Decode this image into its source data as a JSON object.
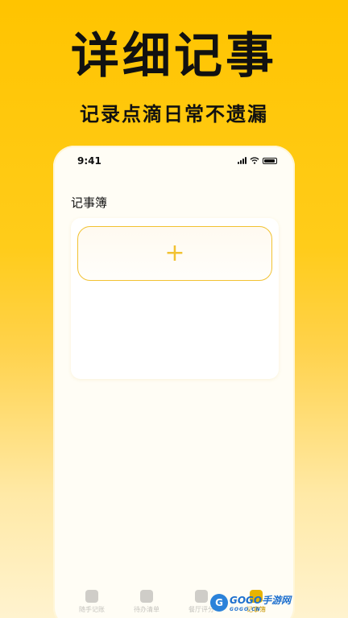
{
  "hero": {
    "title": "详细记事",
    "subtitle": "记录点滴日常不遗漏"
  },
  "status_bar": {
    "time": "9:41"
  },
  "screen": {
    "title": "记事簿",
    "add_button_label": "+"
  },
  "tabbar": {
    "items": [
      {
        "label": "随手记账",
        "icon": "edit-document-icon"
      },
      {
        "label": "待办清单",
        "icon": "list-icon"
      },
      {
        "label": "餐厅评分",
        "icon": "dining-icon"
      },
      {
        "label": "记事簿",
        "icon": "notebook-icon",
        "active": true
      }
    ]
  },
  "watermark": {
    "logo": "G",
    "text": "GOGO手游网",
    "sub": "GOGO.CN"
  },
  "colors": {
    "accent": "#f2c232",
    "background_top": "#ffc400",
    "background_bottom": "#fff3cf"
  }
}
